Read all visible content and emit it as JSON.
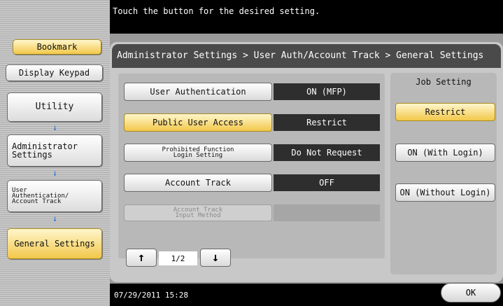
{
  "header": {
    "message": "Touch the button for the desired setting."
  },
  "breadcrumb": "Administrator Settings > User Auth/Account Track  > General Settings",
  "sidebar": {
    "bookmark": "Bookmark",
    "display_keypad": "Display Keypad",
    "utility": "Utility",
    "administrator_settings": "Administrator\nSettings",
    "user_auth_account_track": "User\nAuthentication/\nAccount Track",
    "general_settings": "General Settings",
    "arrow": "↓"
  },
  "settings": [
    {
      "label": "User Authentication",
      "value": "ON (MFP)"
    },
    {
      "label": "Public User Access",
      "value": "Restrict"
    },
    {
      "label": "Prohibited Function\nLogin Setting",
      "value": "Do Not Request"
    },
    {
      "label": "Account Track",
      "value": "OFF"
    },
    {
      "label": "Account Track\nInput Method",
      "value": ""
    }
  ],
  "job_setting": {
    "title": "Job Setting",
    "options": [
      "Restrict",
      "ON (With Login)",
      "ON (Without Login)"
    ]
  },
  "pager": {
    "up": "↑",
    "down": "↓",
    "indicator": "1/2"
  },
  "footer": {
    "datetime": "07/29/2011   15:28",
    "ok": "OK"
  },
  "colors": {
    "highlight": "#f2c84a",
    "value_bg": "#2e2e2e",
    "arrow": "#1f6ed4"
  }
}
